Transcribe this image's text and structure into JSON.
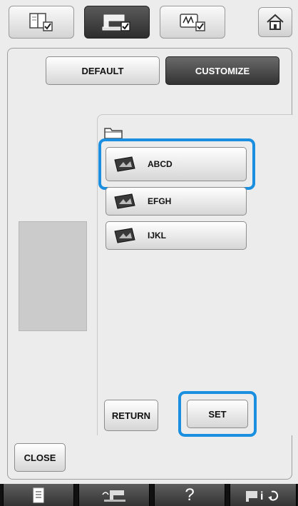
{
  "top_tabs": [
    {
      "icon": "book-check-icon",
      "active": false
    },
    {
      "icon": "machine-check-icon",
      "active": true
    },
    {
      "icon": "embroidery-frame-check-icon",
      "active": false
    }
  ],
  "home_icon": "home-icon",
  "mode_buttons": {
    "default_label": "DEFAULT",
    "customize_label": "CUSTOMIZE",
    "selected": "CUSTOMIZE"
  },
  "folder_icon": "folder-icon",
  "file_items": [
    {
      "label": "ABCD",
      "icon": "image-file-icon",
      "selected": true
    },
    {
      "label": "EFGH",
      "icon": "image-file-icon",
      "selected": false
    },
    {
      "label": "IJKL",
      "icon": "image-file-icon",
      "selected": false
    }
  ],
  "actions": {
    "return_label": "RETURN",
    "set_label": "SET",
    "close_label": "CLOSE"
  },
  "bottom_bar": [
    {
      "icon": "document-icon"
    },
    {
      "icon": "sewing-machine-icon"
    },
    {
      "text": "?",
      "icon": "help-icon"
    },
    {
      "icon": "settings-info-icon"
    }
  ],
  "colors": {
    "highlight": "#1a8fe0",
    "active_tab": "#333333",
    "panel": "#ececec"
  }
}
